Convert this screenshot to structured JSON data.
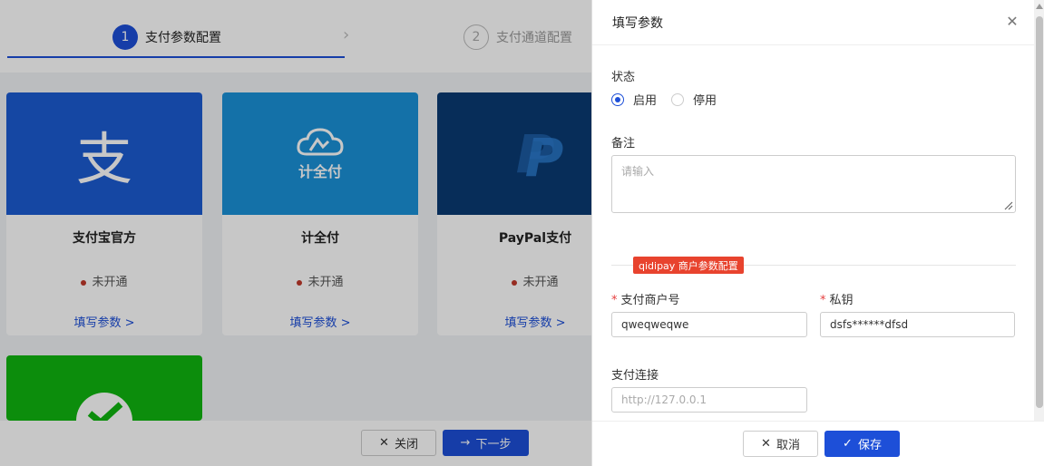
{
  "steps": [
    {
      "num": "1",
      "label": "支付参数配置"
    },
    {
      "num": "2",
      "label": "支付通道配置"
    }
  ],
  "cards": [
    {
      "name": "支付宝官方",
      "status": "未开通",
      "link": "填写参数 >",
      "color": "#1677ff",
      "icon": "alipay-logo-icon",
      "glyph": "支"
    },
    {
      "name": "计全付",
      "status": "未开通",
      "link": "填写参数 >",
      "color": "#1aa3e8",
      "icon": "jiquanfu-logo-icon",
      "glyph": "计全付"
    },
    {
      "name": "PayPal支付",
      "status": "未开通",
      "link": "填写参数 >",
      "color": "#003b7a",
      "icon": "paypal-logo-icon",
      "glyph": "P"
    },
    {
      "name": "",
      "status": "",
      "link": "",
      "color": "#09bb07",
      "icon": "wechat-pay-logo-icon"
    }
  ],
  "background_footer": {
    "close": "关闭",
    "next": "下一步"
  },
  "drawer": {
    "title": "填写参数",
    "status_label": "状态",
    "status_options": [
      "启用",
      "停用"
    ],
    "status_selected": "启用",
    "remark_label": "备注",
    "remark_placeholder": "请输入",
    "section_tag": "qidipay 商户参数配置",
    "merchant_label": "支付商户号",
    "merchant_value": "qweqweqwe",
    "secret_label": "私钥",
    "secret_value": "dsfs******dfsd",
    "link_label": "支付连接",
    "link_placeholder": "http://127.0.0.1",
    "cancel": "取消",
    "save": "保存"
  },
  "colors": {
    "primary": "#1d4fd8",
    "danger": "#e8432e"
  }
}
